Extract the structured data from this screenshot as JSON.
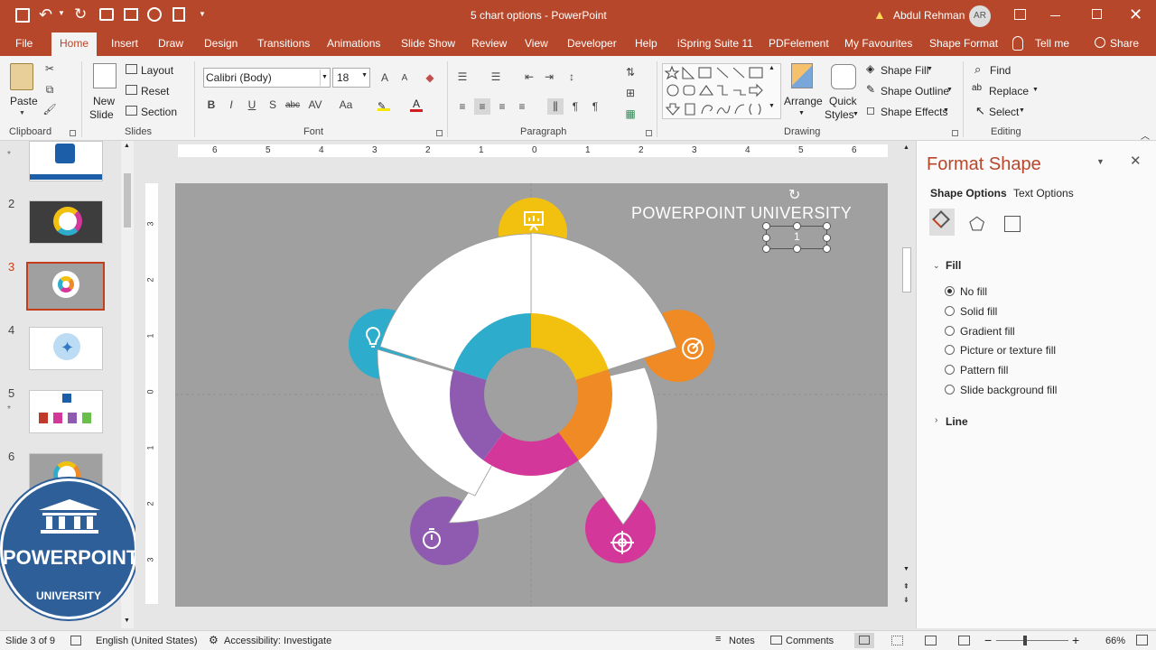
{
  "titlebar": {
    "document_title": "5 chart options  -  PowerPoint",
    "user_name": "Abdul Rehman",
    "user_initials": "AR"
  },
  "tabs": [
    "File",
    "Home",
    "Insert",
    "Draw",
    "Design",
    "Transitions",
    "Animations",
    "Slide Show",
    "Review",
    "View",
    "Developer",
    "Help",
    "iSpring Suite 11",
    "PDFelement",
    "My Favourites",
    "Shape Format"
  ],
  "tell_me": "Tell me",
  "share": "Share",
  "ribbon": {
    "clipboard": {
      "paste": "Paste",
      "label": "Clipboard"
    },
    "slides": {
      "new_slide_line1": "New",
      "new_slide_line2": "Slide",
      "layout": "Layout",
      "reset": "Reset",
      "section": "Section",
      "label": "Slides"
    },
    "font": {
      "font_name": "Calibri (Body)",
      "font_size": "18",
      "label": "Font"
    },
    "paragraph": {
      "label": "Paragraph"
    },
    "drawing": {
      "arrange": "Arrange",
      "quick_styles_line1": "Quick",
      "quick_styles_line2": "Styles",
      "shape_fill": "Shape Fill",
      "shape_outline": "Shape Outline",
      "shape_effects": "Shape Effects",
      "label": "Drawing"
    },
    "editing": {
      "find": "Find",
      "replace": "Replace",
      "select": "Select",
      "label": "Editing"
    }
  },
  "ruler_numbers": [
    "6",
    "5",
    "4",
    "3",
    "2",
    "1",
    "0",
    "1",
    "2",
    "3",
    "4",
    "5",
    "6"
  ],
  "vruler_numbers": [
    "3",
    "2",
    "1",
    "0",
    "1",
    "2",
    "3"
  ],
  "slide_numbers": [
    "2",
    "3",
    "4",
    "5",
    "6"
  ],
  "current_slide": 3,
  "slide": {
    "heading": "POWERPOINT UNIVERSITY",
    "textbox_value": "1",
    "segment_colors": [
      "#f2c110",
      "#f08a24",
      "#d3379a",
      "#8e5bb0",
      "#2eaccb"
    ],
    "icons": [
      "presentation-icon",
      "target-icon",
      "crosshair-icon",
      "stopwatch-icon",
      "lightbulb-icon"
    ]
  },
  "logo": {
    "line1": "POWERPOINT",
    "line2": "UNIVERSITY"
  },
  "format_pane": {
    "title": "Format Shape",
    "tab_shape": "Shape Options",
    "tab_text": "Text Options",
    "fill_header": "Fill",
    "fill_options": [
      "No fill",
      "Solid fill",
      "Gradient fill",
      "Picture or texture fill",
      "Pattern fill",
      "Slide background fill"
    ],
    "selected_fill": "No fill",
    "line_header": "Line"
  },
  "status": {
    "slide_info": "Slide 3 of 9",
    "language": "English (United States)",
    "accessibility": "Accessibility: Investigate",
    "notes": "Notes",
    "comments": "Comments",
    "zoom": "66%"
  },
  "colors": {
    "accent": "#b7472a",
    "slide_bg": "#a0a0a0",
    "pane_title": "#b7472a"
  }
}
